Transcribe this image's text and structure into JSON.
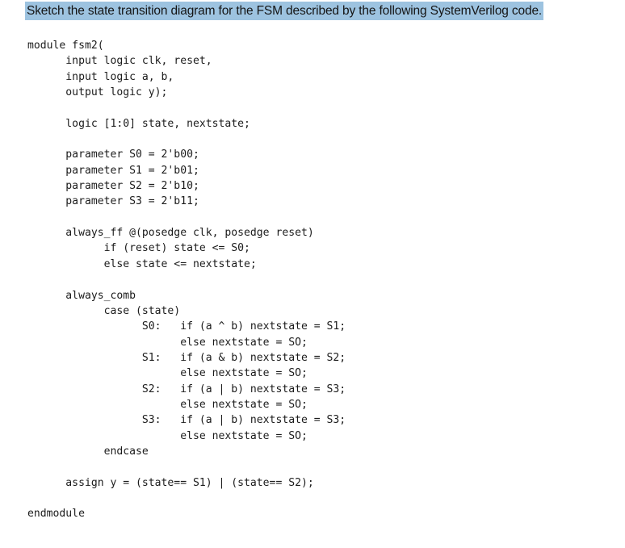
{
  "document": {
    "background_color": "#ffffff",
    "text_color": "#1a1a1a",
    "clipped_text_above": "",
    "question": {
      "text": "Sketch the state transition diagram for the FSM described by the following SystemVerilog code.",
      "highlight_color": "#9dc3e0",
      "highlighted": true
    },
    "code": {
      "language": "SystemVerilog",
      "module_name": "fsm2",
      "lines": [
        "module fsm2(",
        "      input logic clk, reset,",
        "      input logic a, b,",
        "      output logic y);",
        "",
        "      logic [1:0] state, nextstate;",
        "",
        "      parameter S0 = 2'b00;",
        "      parameter S1 = 2'b01;",
        "      parameter S2 = 2'b10;",
        "      parameter S3 = 2'b11;",
        "",
        "      always_ff @(posedge clk, posedge reset)",
        "            if (reset) state <= S0;",
        "            else state <= nextstate;",
        "",
        "      always_comb",
        "            case (state)",
        "                  S0:   if (a ^ b) nextstate = S1;",
        "                        else nextstate = SO;",
        "                  S1:   if (a & b) nextstate = S2;",
        "                        else nextstate = SO;",
        "                  S2:   if (a | b) nextstate = S3;",
        "                        else nextstate = SO;",
        "                  S3:   if (a | b) nextstate = S3;",
        "                        else nextstate = SO;",
        "            endcase",
        "",
        "      assign y = (state== S1) | (state== S2);",
        "",
        "endmodule"
      ],
      "full_text": "module fsm2(\n      input logic clk, reset,\n      input logic a, b,\n      output logic y);\n\n      logic [1:0] state, nextstate;\n\n      parameter S0 = 2'b00;\n      parameter S1 = 2'b01;\n      parameter S2 = 2'b10;\n      parameter S3 = 2'b11;\n\n      always_ff @(posedge clk, posedge reset)\n            if (reset) state <= S0;\n            else state <= nextstate;\n\n      always_comb\n            case (state)\n                  S0:   if (a ^ b) nextstate = S1;\n                        else nextstate = SO;\n                  S1:   if (a & b) nextstate = S2;\n                        else nextstate = SO;\n                  S2:   if (a | b) nextstate = S3;\n                        else nextstate = SO;\n                  S3:   if (a | b) nextstate = S3;\n                        else nextstate = SO;\n            endcase\n\n      assign y = (state== S1) | (state== S2);\n\nendmodule"
    }
  }
}
